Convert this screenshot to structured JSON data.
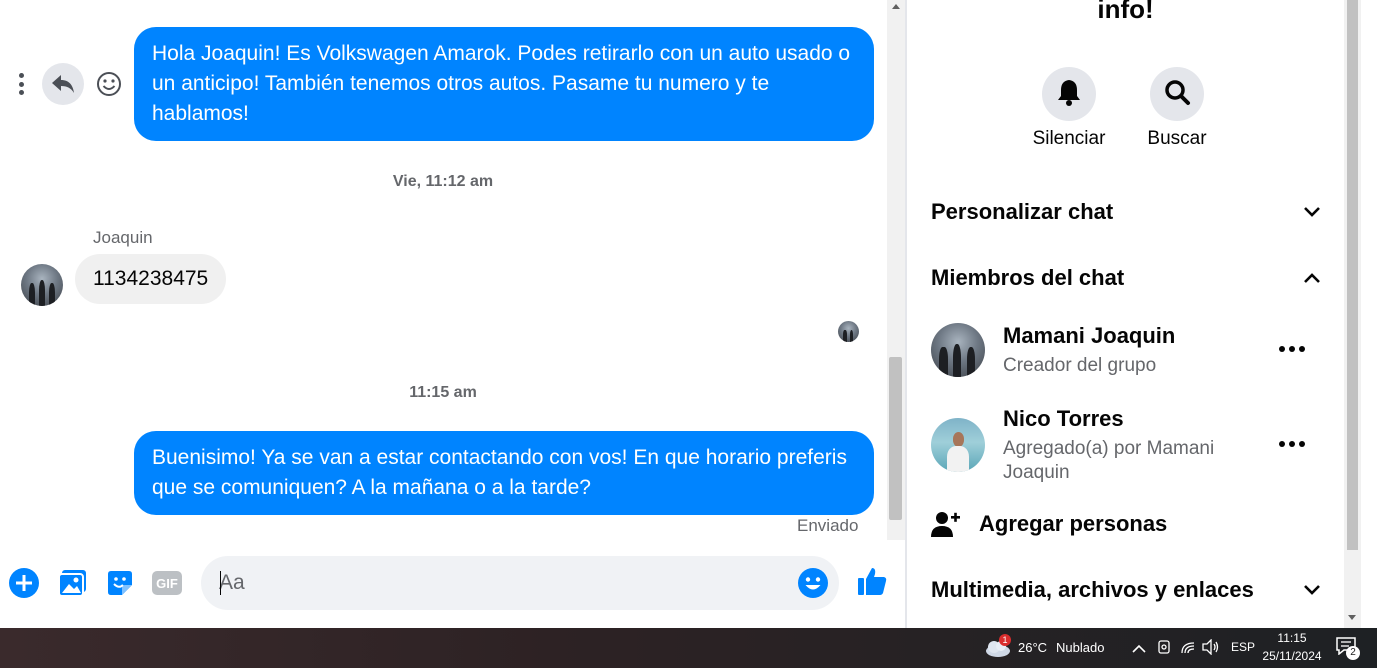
{
  "chat": {
    "messages": [
      {
        "text": "Hola Joaquin! Es Volkswagen Amarok. Podes retirarlo con un auto usado o un anticipo! También tenemos otros autos. Pasame tu numero y te hablamos!"
      },
      {
        "timestamp": "Vie, 11:12 am"
      },
      {
        "sender": "Joaquin",
        "text": "1134238475"
      },
      {
        "timestamp": "11:15 am"
      },
      {
        "text": "Buenisimo! Ya se van a estar contactando con vos! En que horario preferis que se comuniquen? A la mañana o a la tarde?"
      }
    ],
    "status": "Enviado",
    "composer_placeholder": "Aa"
  },
  "panel": {
    "title": "info!",
    "actions": [
      {
        "label": "Silenciar",
        "icon": "bell-icon"
      },
      {
        "label": "Buscar",
        "icon": "search-icon"
      }
    ],
    "sections": {
      "customize": "Personalizar chat",
      "members": "Miembros del chat",
      "media": "Multimedia, archivos y enlaces"
    },
    "members": [
      {
        "name": "Mamani Joaquin",
        "subtitle": "Creador del grupo"
      },
      {
        "name": "Nico Torres",
        "subtitle": "Agregado(a) por Mamani Joaquin"
      }
    ],
    "add_people": "Agregar personas"
  },
  "taskbar": {
    "weather": "26°C",
    "weather_text": "Nublado",
    "weather_badge": "1",
    "language": "ESP",
    "time": "11:15",
    "date": "25/11/2024",
    "notifications": "2"
  },
  "colors": {
    "accent": "#0084ff",
    "bubble_in": "#f0f0f0"
  }
}
